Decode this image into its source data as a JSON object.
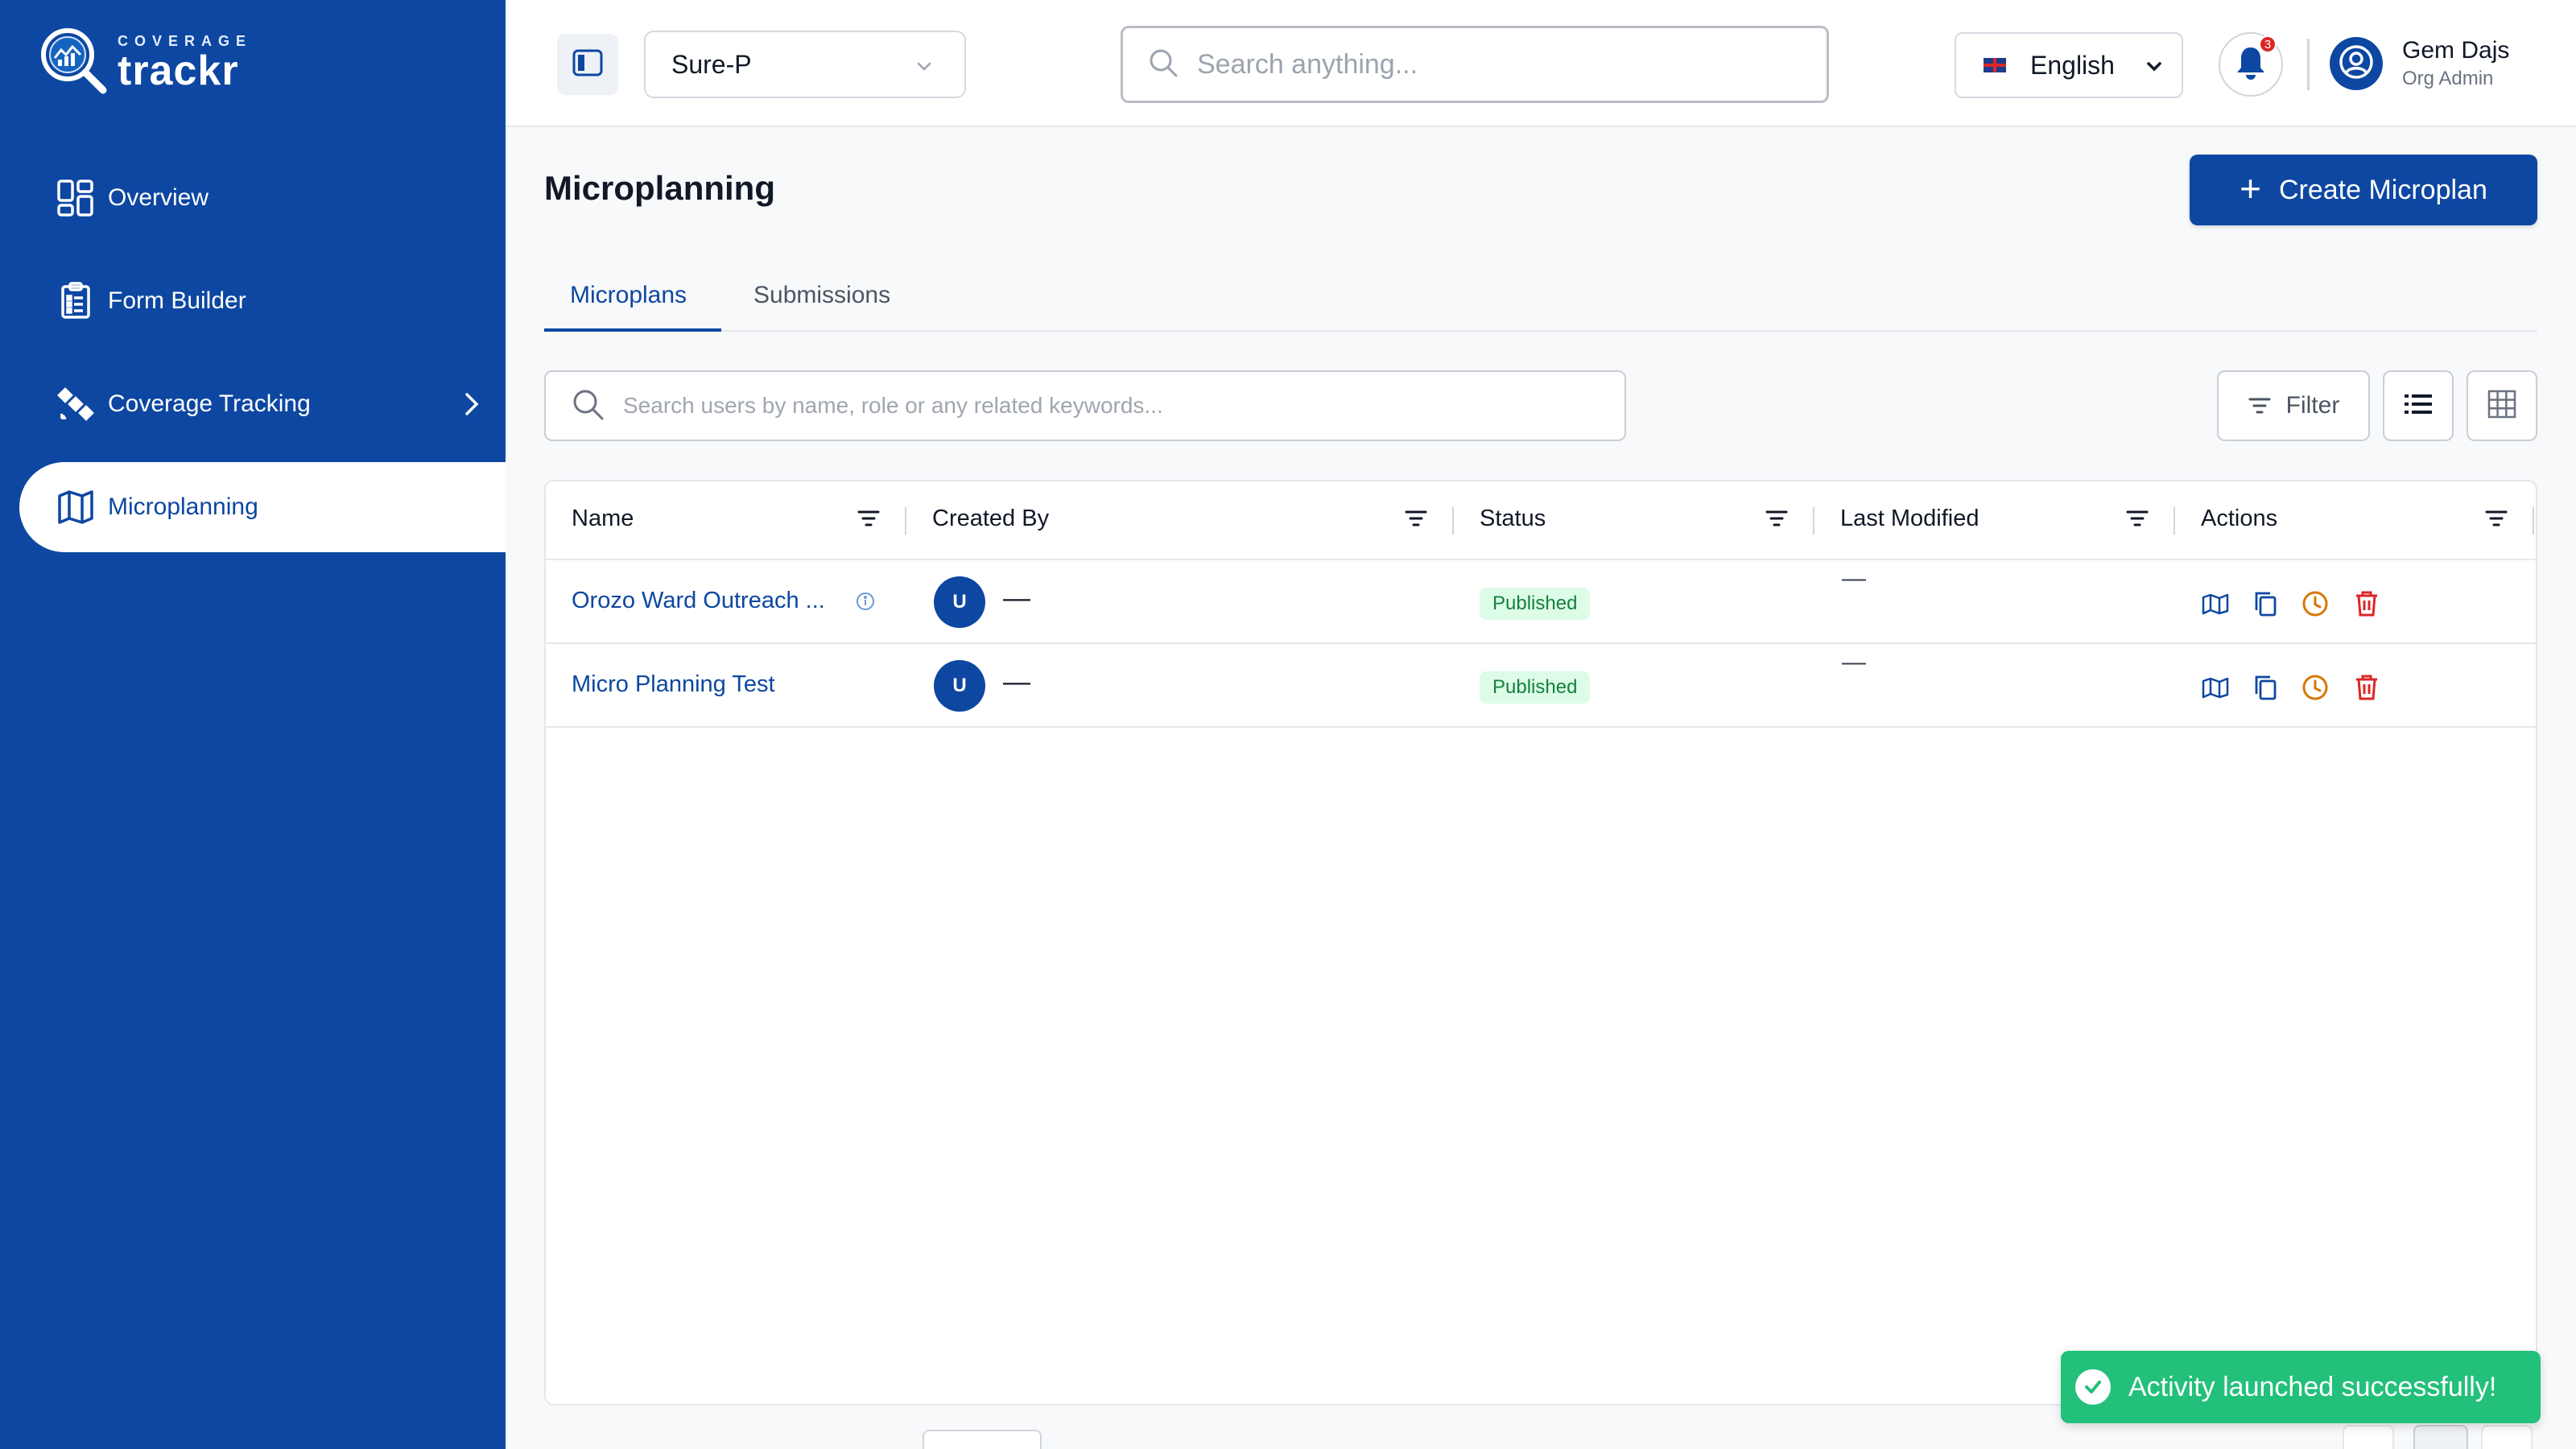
{
  "brand": {
    "small": "COVERAGE",
    "big": "trackr",
    "logo_icon": "magnifier-globe-logo"
  },
  "sidebar": {
    "items": [
      {
        "label": "Overview",
        "icon": "dashboard-grid-icon"
      },
      {
        "label": "Form Builder",
        "icon": "clipboard-form-icon"
      },
      {
        "label": "Coverage Tracking",
        "icon": "satellite-icon",
        "has_children": true
      },
      {
        "label": "Microplanning",
        "icon": "map-icon",
        "active": true
      }
    ]
  },
  "header": {
    "workspace": "Sure-P",
    "search_placeholder": "Search anything...",
    "language": "English",
    "notifications_count": "3",
    "user_name": "Gem Dajs",
    "user_role": "Org Admin"
  },
  "page": {
    "title": "Microplanning",
    "create_button": "Create Microplan",
    "tabs": [
      {
        "label": "Microplans",
        "active": true
      },
      {
        "label": "Submissions",
        "active": false
      }
    ],
    "list_search_placeholder": "Search users by name, role or any related keywords...",
    "filter_label": "Filter"
  },
  "table": {
    "columns": [
      "Name",
      "Created By",
      "Status",
      "Last Modified",
      "Actions"
    ],
    "rows": [
      {
        "name": "Orozo Ward Outreach ...",
        "avatar": "U",
        "created_by": "—",
        "status": "Published",
        "last_modified": "—"
      },
      {
        "name": "Micro Planning Test",
        "avatar": "U",
        "created_by": "—",
        "status": "Published",
        "last_modified": "—"
      }
    ]
  },
  "toast": {
    "message": "Activity launched successfully!"
  },
  "colors": {
    "primary": "#0d47a1",
    "success": "#22c07a",
    "status_bg": "#dcfce7",
    "status_text": "#15803d",
    "danger": "#dc2626",
    "warning": "#d97706"
  }
}
